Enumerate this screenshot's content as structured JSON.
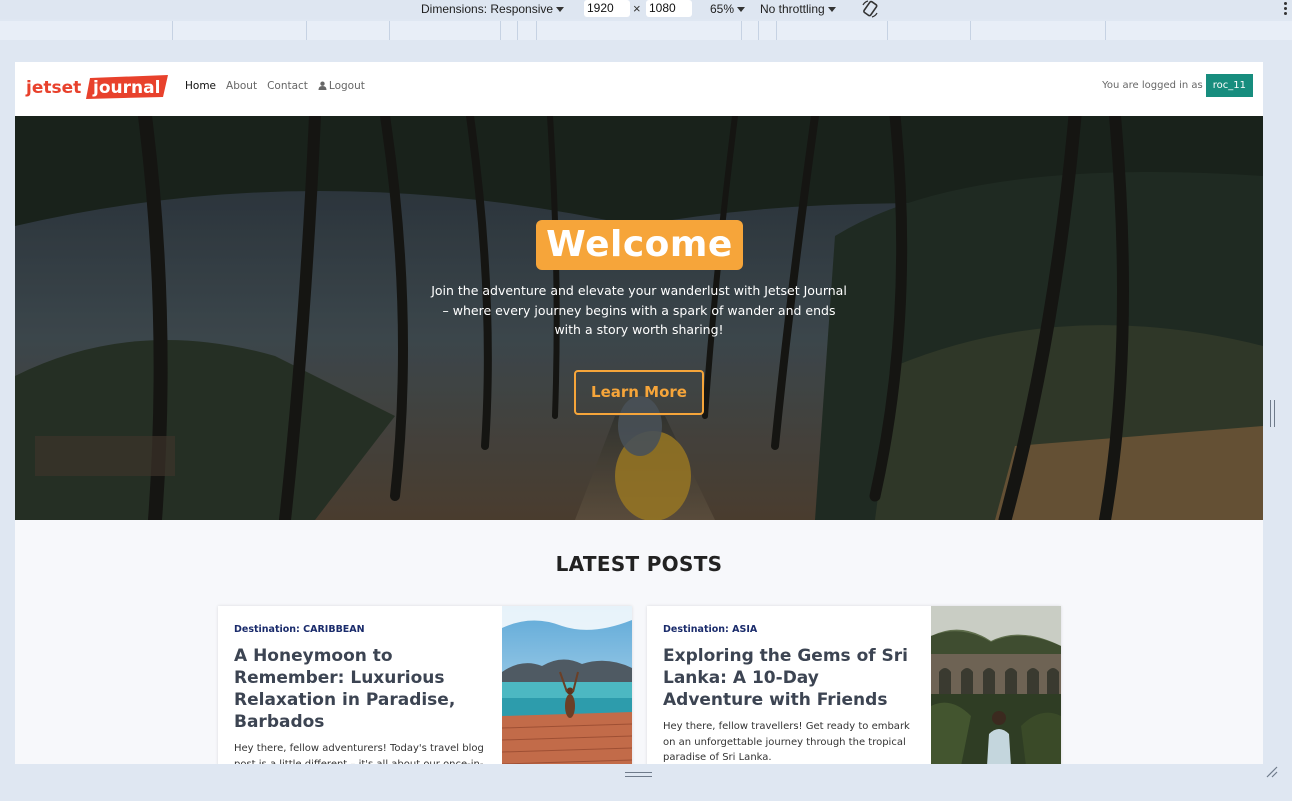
{
  "devtools": {
    "dimensions_label": "Dimensions: Responsive",
    "width_value": "1920",
    "height_value": "1080",
    "times_symbol": "×",
    "zoom": "65%",
    "throttling": "No throttling"
  },
  "site": {
    "logo_text_a": "jetset",
    "logo_text_b": "journal",
    "nav": {
      "home": "Home",
      "about": "About",
      "contact": "Contact",
      "logout": "Logout"
    },
    "login_prefix": "You are logged in as",
    "username": "roc_11"
  },
  "hero": {
    "title": "Welcome",
    "tagline": "Join the adventure and elevate your wanderlust with Jetset Journal – where every journey begins with a spark of wander and ends with a story worth sharing!",
    "button": "Learn More"
  },
  "posts": {
    "section_title": "LATEST POSTS",
    "items": [
      {
        "destination": "Destination: CARIBBEAN",
        "title": "A Honeymoon to Remember: Luxurious Relaxation in Paradise, Barbados",
        "excerpt": "Hey there, fellow adventurers! Today's travel blog post is a little different – it's all about our once-in-a-lifetime honeymoon experience in the stunning"
      },
      {
        "destination": "Destination: ASIA",
        "title": "Exploring the Gems of Sri Lanka: A 10-Day Adventure with Friends",
        "excerpt": "Hey there, fellow travellers! Get ready to embark on an unforgettable journey through the tropical paradise of Sri Lanka."
      }
    ]
  },
  "colors": {
    "accent": "#f6a53a",
    "badge": "#178d7e",
    "logo_red": "#e8412c",
    "destination": "#1a2b6b"
  }
}
